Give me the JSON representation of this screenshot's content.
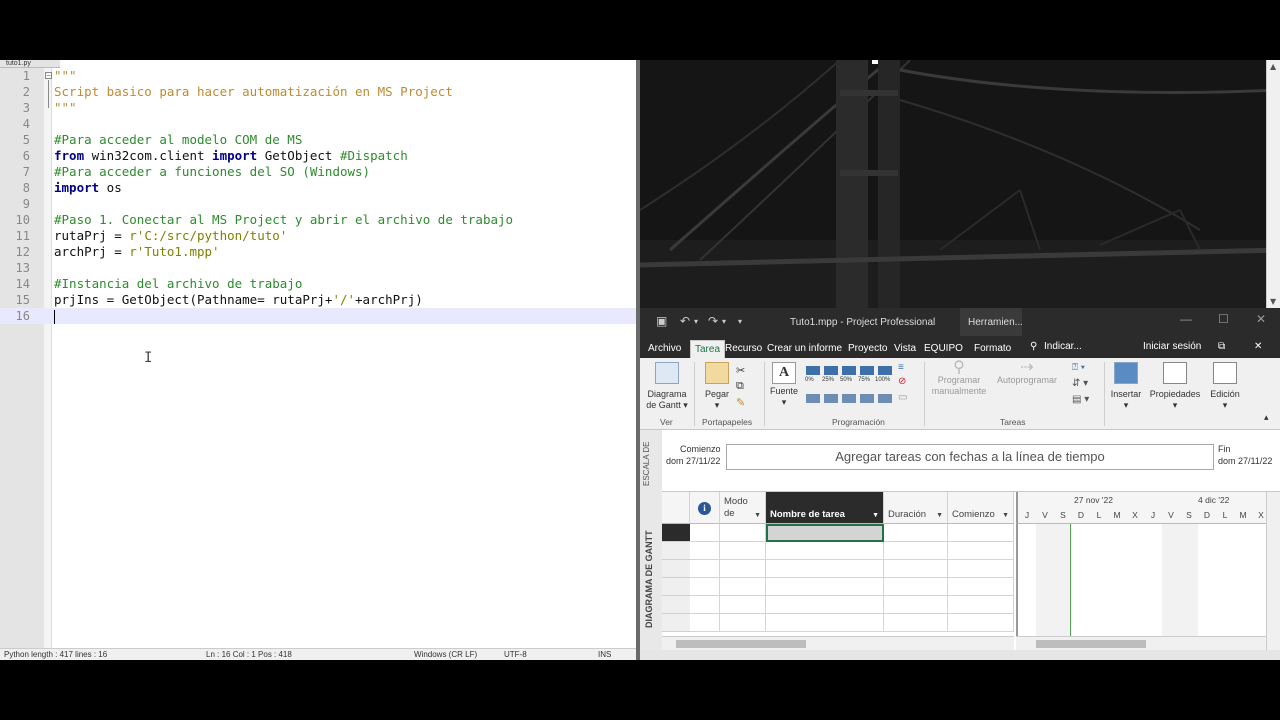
{
  "editor": {
    "tab_label": "tuto1.py",
    "lines": [
      {
        "n": "1",
        "tokens": [
          {
            "c": "doc",
            "t": "\"\"\""
          }
        ]
      },
      {
        "n": "2",
        "tokens": [
          {
            "c": "doc",
            "t": "Script basico para hacer automatización en MS Project"
          }
        ]
      },
      {
        "n": "3",
        "tokens": [
          {
            "c": "doc",
            "t": "\"\"\""
          }
        ]
      },
      {
        "n": "4",
        "tokens": []
      },
      {
        "n": "5",
        "tokens": [
          {
            "c": "cmt",
            "t": "#Para acceder al modelo COM de MS"
          }
        ]
      },
      {
        "n": "6",
        "tokens": [
          {
            "c": "kw",
            "t": "from"
          },
          {
            "c": "id",
            "t": " win32com.client "
          },
          {
            "c": "kw",
            "t": "import"
          },
          {
            "c": "id",
            "t": " GetObject "
          },
          {
            "c": "cmt",
            "t": "#Dispatch"
          }
        ]
      },
      {
        "n": "7",
        "tokens": [
          {
            "c": "cmt",
            "t": "#Para acceder a funciones del SO (Windows)"
          }
        ]
      },
      {
        "n": "8",
        "tokens": [
          {
            "c": "kw",
            "t": "import"
          },
          {
            "c": "id",
            "t": " os"
          }
        ]
      },
      {
        "n": "9",
        "tokens": []
      },
      {
        "n": "10",
        "tokens": [
          {
            "c": "cmt",
            "t": "#Paso 1. Conectar al MS Project y abrir el archivo de trabajo"
          }
        ]
      },
      {
        "n": "11",
        "tokens": [
          {
            "c": "id",
            "t": "rutaPrj = "
          },
          {
            "c": "str",
            "t": "r'C:/src/python/tuto'"
          }
        ]
      },
      {
        "n": "12",
        "tokens": [
          {
            "c": "id",
            "t": "archPrj = "
          },
          {
            "c": "str",
            "t": "r'Tuto1.mpp'"
          }
        ]
      },
      {
        "n": "13",
        "tokens": []
      },
      {
        "n": "14",
        "tokens": [
          {
            "c": "cmt",
            "t": "#Instancia del archivo de trabajo"
          }
        ]
      },
      {
        "n": "15",
        "tokens": [
          {
            "c": "id",
            "t": "prjIns = GetObject(Pathname= rutaPrj+"
          },
          {
            "c": "str",
            "t": "'/'"
          },
          {
            "c": "id",
            "t": "+archPrj)"
          }
        ]
      },
      {
        "n": "16",
        "tokens": []
      }
    ],
    "status": {
      "length": "Python  length : 417   lines : 16",
      "position": "Ln : 16   Col : 1   Pos : 418",
      "eol": "Windows (CR LF)",
      "encoding": "UTF-8",
      "mode": "INS"
    }
  },
  "project": {
    "title": "Tuto1.mpp - Project Professional",
    "context_tab": "Herramien...",
    "tabs": [
      "Archivo",
      "Tarea",
      "Recurso",
      "Crear un informe",
      "Proyecto",
      "Vista",
      "EQUIPO",
      "Formato"
    ],
    "search": "Indicar...",
    "signin": "Iniciar sesión",
    "ribbon": {
      "gantt_btn": "Diagrama de Gantt",
      "paste_btn": "Pegar",
      "font_btn": "Fuente",
      "manual_btn": "Programar manualmente",
      "auto_btn": "Autoprogramar",
      "insert_btn": "Insertar",
      "props_btn": "Propiedades",
      "edit_btn": "Edición",
      "groups": {
        "ver": "Ver",
        "portapapeles": "Portapapeles",
        "programacion": "Programación",
        "tareas": "Tareas"
      },
      "pct": [
        "0%",
        "25%",
        "50%",
        "75%",
        "100%"
      ]
    },
    "timeline": {
      "side_label": "ESCALA DE",
      "start_label": "Comienzo",
      "start_date": "dom 27/11/22",
      "end_label": "Fin",
      "end_date": "dom 27/11/22",
      "placeholder": "Agregar tareas con fechas a la línea de tiempo"
    },
    "grid": {
      "side_label": "DIAGRAMA DE GANTT",
      "info_icon": "i",
      "col_mode": "Modo de",
      "col_name": "Nombre de tarea",
      "col_duration": "Duración",
      "col_start": "Comienzo",
      "week1": "27 nov '22",
      "week2": "4 dic '22",
      "days": [
        "J",
        "V",
        "S",
        "D",
        "L",
        "M",
        "X",
        "J",
        "V",
        "S",
        "D",
        "L",
        "M",
        "X"
      ]
    }
  }
}
